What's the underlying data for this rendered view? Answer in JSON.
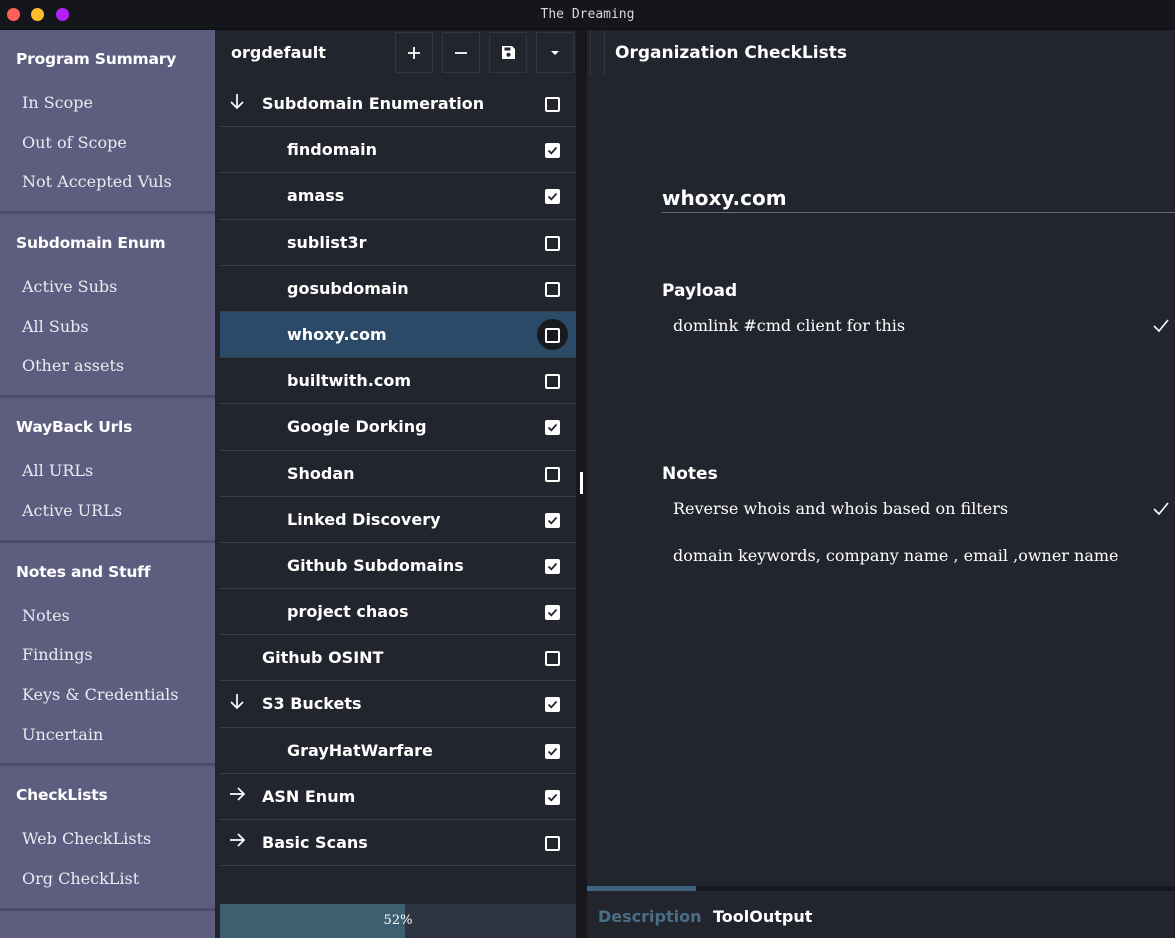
{
  "window": {
    "title": "The Dreaming"
  },
  "sidebar": {
    "sections": [
      {
        "title": "Program Summary",
        "items": [
          "In Scope",
          "Out of Scope",
          "Not Accepted Vuls"
        ]
      },
      {
        "title": "Subdomain Enum",
        "items": [
          "Active Subs",
          "All Subs",
          "Other assets"
        ]
      },
      {
        "title": "WayBack Urls",
        "items": [
          "All URLs",
          "Active URLs"
        ]
      },
      {
        "title": "Notes and Stuff",
        "items": [
          "Notes",
          "Findings",
          "Keys & Credentials",
          "Uncertain"
        ]
      },
      {
        "title": "CheckLists",
        "items": [
          "Web CheckLists",
          "Org CheckList"
        ]
      }
    ]
  },
  "checklist_panel": {
    "org_name": "orgdefault",
    "buttons": {
      "add": "+",
      "remove": "−",
      "save": "save-icon",
      "menu": "chevron-down-icon"
    },
    "rows": [
      {
        "label": "Subdomain Enumeration",
        "level": 0,
        "arrow": "down",
        "checked": false
      },
      {
        "label": "findomain",
        "level": 1,
        "arrow": "none",
        "checked": true
      },
      {
        "label": "amass",
        "level": 1,
        "arrow": "none",
        "checked": true
      },
      {
        "label": "sublist3r",
        "level": 1,
        "arrow": "none",
        "checked": false
      },
      {
        "label": "gosubdomain",
        "level": 1,
        "arrow": "none",
        "checked": false
      },
      {
        "label": "whoxy.com",
        "level": 1,
        "arrow": "none",
        "checked": false,
        "selected": true
      },
      {
        "label": "builtwith.com",
        "level": 1,
        "arrow": "none",
        "checked": false
      },
      {
        "label": "Google Dorking",
        "level": 1,
        "arrow": "none",
        "checked": true
      },
      {
        "label": "Shodan",
        "level": 1,
        "arrow": "none",
        "checked": false
      },
      {
        "label": "Linked Discovery",
        "level": 1,
        "arrow": "none",
        "checked": true
      },
      {
        "label": "Github Subdomains",
        "level": 1,
        "arrow": "none",
        "checked": true
      },
      {
        "label": "project chaos",
        "level": 1,
        "arrow": "none",
        "checked": true
      },
      {
        "label": "Github OSINT",
        "level": 0,
        "arrow": "none",
        "checked": false
      },
      {
        "label": "S3 Buckets",
        "level": 0,
        "arrow": "down",
        "checked": true
      },
      {
        "label": "GrayHatWarfare",
        "level": 1,
        "arrow": "none",
        "checked": true
      },
      {
        "label": "ASN Enum",
        "level": 0,
        "arrow": "right",
        "checked": true
      },
      {
        "label": "Basic Scans",
        "level": 0,
        "arrow": "right",
        "checked": false
      }
    ],
    "progress": {
      "value": 0.52,
      "label": "52%"
    }
  },
  "detail": {
    "header_title": "Organization CheckLists",
    "item_name": "whoxy.com",
    "payload_label": "Payload",
    "payload_lines": [
      "domlink #cmd client for this"
    ],
    "notes_label": "Notes",
    "notes_lines": [
      "Reverse whois and whois based on filters",
      "domain keywords, company name , email ,owner name"
    ],
    "tabs": [
      "Description",
      "ToolOutput"
    ],
    "active_tab": "Description"
  },
  "colors": {
    "sidebar_bg": "#5d5e7f",
    "panel_bg": "#23252e",
    "selected_row": "#2b4a68",
    "progress_fill": "#3d5f70",
    "traffic_red": "#fe5f57",
    "traffic_yellow": "#febc2e",
    "traffic_purple": "#b421f7"
  }
}
